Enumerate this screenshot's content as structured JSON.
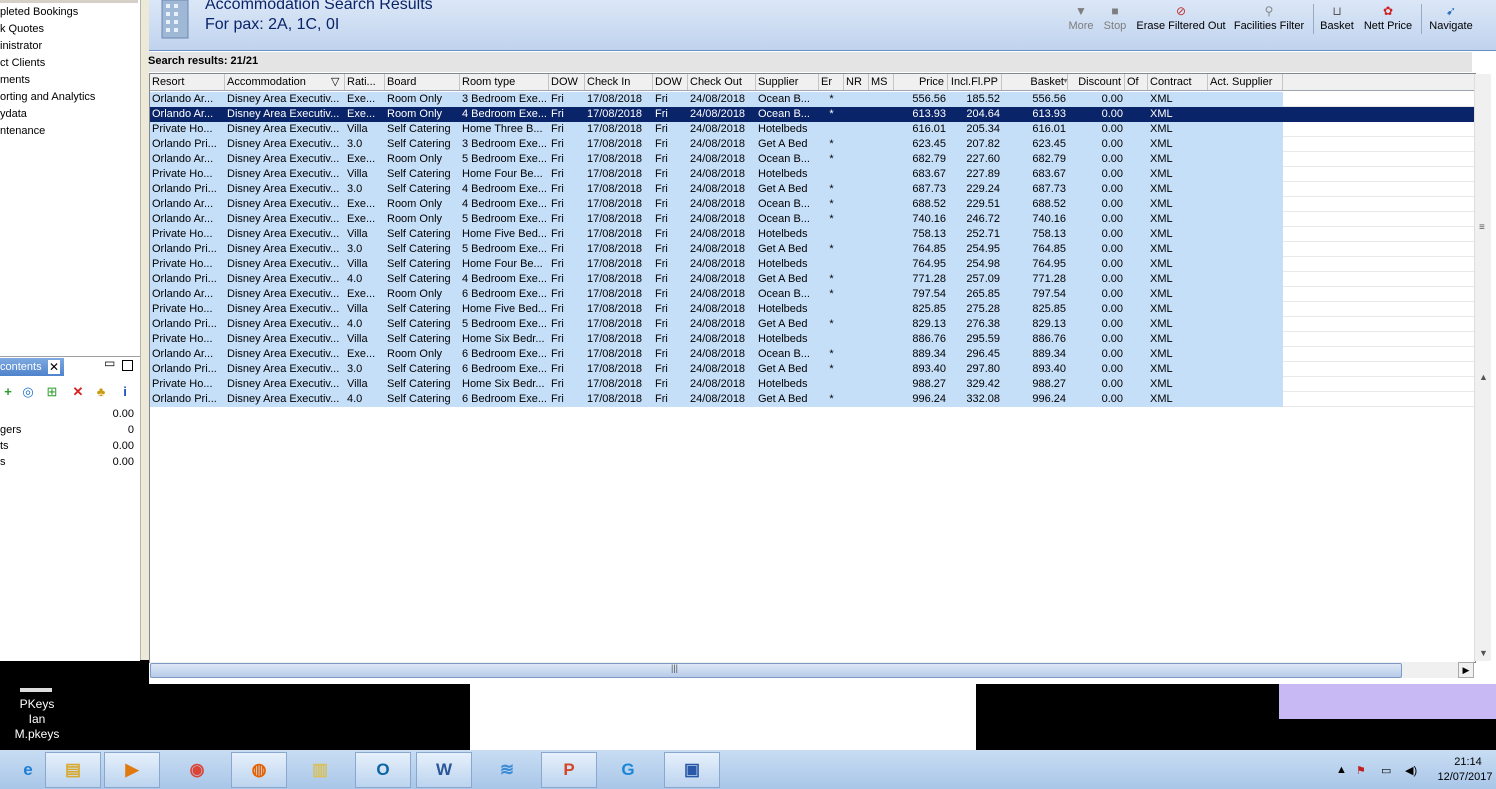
{
  "left_nav": {
    "items": [
      "pleted Bookings",
      "k Quotes",
      "inistrator",
      "ct Clients",
      "ments",
      "orting and Analytics",
      "ydata",
      "ntenance"
    ]
  },
  "contents_panel": {
    "tab_label": "contents",
    "summary": [
      {
        "label": "",
        "value": "0.00"
      },
      {
        "label": "gers",
        "value": "0"
      },
      {
        "label": "ts",
        "value": "0.00"
      },
      {
        "label": "s",
        "value": "0.00"
      }
    ]
  },
  "header": {
    "title": "Accommodation Search Results",
    "subtitle": "For pax: 2A, 1C, 0I"
  },
  "toolbar": {
    "more": "More",
    "stop": "Stop",
    "erase": "Erase Filtered Out",
    "facilities": "Facilities Filter",
    "basket": "Basket",
    "nett_price": "Nett Price",
    "navigate": "Navigate"
  },
  "results": {
    "label": "Search results: 21/21"
  },
  "grid": {
    "columns": [
      "Resort",
      "Accommodation",
      "Rati...",
      "Board",
      "Room type",
      "DOW",
      "Check In",
      "DOW",
      "Check Out",
      "Supplier",
      "Er",
      "NR",
      "MS",
      "Price",
      "Incl.Fl.PP",
      "Basket",
      "Discount",
      "Of",
      "Contract",
      "Act. Supplier"
    ],
    "rows": [
      [
        "Orlando Ar...",
        "Disney Area Executiv...",
        "Exe...",
        "Room Only",
        "3 Bedroom Exe...",
        "Fri",
        "17/08/2018",
        "Fri",
        "24/08/2018",
        "Ocean B...",
        "*",
        "",
        "",
        "556.56",
        "185.52",
        "556.56",
        "0.00",
        "",
        "XML",
        ""
      ],
      [
        "Orlando Ar...",
        "Disney Area Executiv...",
        "Exe...",
        "Room Only",
        "4 Bedroom Exe...",
        "Fri",
        "17/08/2018",
        "Fri",
        "24/08/2018",
        "Ocean B...",
        "*",
        "",
        "",
        "613.93",
        "204.64",
        "613.93",
        "0.00",
        "",
        "XML",
        ""
      ],
      [
        "Private Ho...",
        "Disney Area Executiv...",
        "Villa",
        "Self Catering",
        "Home Three B...",
        "Fri",
        "17/08/2018",
        "Fri",
        "24/08/2018",
        "Hotelbeds",
        "",
        "",
        "",
        "616.01",
        "205.34",
        "616.01",
        "0.00",
        "",
        "XML",
        ""
      ],
      [
        "Orlando Pri...",
        "Disney Area Executiv...",
        "3.0",
        "Self Catering",
        "3 Bedroom Exe...",
        "Fri",
        "17/08/2018",
        "Fri",
        "24/08/2018",
        "Get A Bed",
        "*",
        "",
        "",
        "623.45",
        "207.82",
        "623.45",
        "0.00",
        "",
        "XML",
        ""
      ],
      [
        "Orlando Ar...",
        "Disney Area Executiv...",
        "Exe...",
        "Room Only",
        "5 Bedroom Exe...",
        "Fri",
        "17/08/2018",
        "Fri",
        "24/08/2018",
        "Ocean B...",
        "*",
        "",
        "",
        "682.79",
        "227.60",
        "682.79",
        "0.00",
        "",
        "XML",
        ""
      ],
      [
        "Private Ho...",
        "Disney Area Executiv...",
        "Villa",
        "Self Catering",
        "Home Four Be...",
        "Fri",
        "17/08/2018",
        "Fri",
        "24/08/2018",
        "Hotelbeds",
        "",
        "",
        "",
        "683.67",
        "227.89",
        "683.67",
        "0.00",
        "",
        "XML",
        ""
      ],
      [
        "Orlando Pri...",
        "Disney Area Executiv...",
        "3.0",
        "Self Catering",
        "4 Bedroom Exe...",
        "Fri",
        "17/08/2018",
        "Fri",
        "24/08/2018",
        "Get A Bed",
        "*",
        "",
        "",
        "687.73",
        "229.24",
        "687.73",
        "0.00",
        "",
        "XML",
        ""
      ],
      [
        "Orlando Ar...",
        "Disney Area Executiv...",
        "Exe...",
        "Room Only",
        "4 Bedroom Exe...",
        "Fri",
        "17/08/2018",
        "Fri",
        "24/08/2018",
        "Ocean B...",
        "*",
        "",
        "",
        "688.52",
        "229.51",
        "688.52",
        "0.00",
        "",
        "XML",
        ""
      ],
      [
        "Orlando Ar...",
        "Disney Area Executiv...",
        "Exe...",
        "Room Only",
        "5 Bedroom Exe...",
        "Fri",
        "17/08/2018",
        "Fri",
        "24/08/2018",
        "Ocean B...",
        "*",
        "",
        "",
        "740.16",
        "246.72",
        "740.16",
        "0.00",
        "",
        "XML",
        ""
      ],
      [
        "Private Ho...",
        "Disney Area Executiv...",
        "Villa",
        "Self Catering",
        "Home Five Bed...",
        "Fri",
        "17/08/2018",
        "Fri",
        "24/08/2018",
        "Hotelbeds",
        "",
        "",
        "",
        "758.13",
        "252.71",
        "758.13",
        "0.00",
        "",
        "XML",
        ""
      ],
      [
        "Orlando Pri...",
        "Disney Area Executiv...",
        "3.0",
        "Self Catering",
        "5 Bedroom Exe...",
        "Fri",
        "17/08/2018",
        "Fri",
        "24/08/2018",
        "Get A Bed",
        "*",
        "",
        "",
        "764.85",
        "254.95",
        "764.85",
        "0.00",
        "",
        "XML",
        ""
      ],
      [
        "Private Ho...",
        "Disney Area Executiv...",
        "Villa",
        "Self Catering",
        "Home Four Be...",
        "Fri",
        "17/08/2018",
        "Fri",
        "24/08/2018",
        "Hotelbeds",
        "",
        "",
        "",
        "764.95",
        "254.98",
        "764.95",
        "0.00",
        "",
        "XML",
        ""
      ],
      [
        "Orlando Pri...",
        "Disney Area Executiv...",
        "4.0",
        "Self Catering",
        "4 Bedroom Exe...",
        "Fri",
        "17/08/2018",
        "Fri",
        "24/08/2018",
        "Get A Bed",
        "*",
        "",
        "",
        "771.28",
        "257.09",
        "771.28",
        "0.00",
        "",
        "XML",
        ""
      ],
      [
        "Orlando Ar...",
        "Disney Area Executiv...",
        "Exe...",
        "Room Only",
        "6 Bedroom Exe...",
        "Fri",
        "17/08/2018",
        "Fri",
        "24/08/2018",
        "Ocean B...",
        "*",
        "",
        "",
        "797.54",
        "265.85",
        "797.54",
        "0.00",
        "",
        "XML",
        ""
      ],
      [
        "Private Ho...",
        "Disney Area Executiv...",
        "Villa",
        "Self Catering",
        "Home Five Bed...",
        "Fri",
        "17/08/2018",
        "Fri",
        "24/08/2018",
        "Hotelbeds",
        "",
        "",
        "",
        "825.85",
        "275.28",
        "825.85",
        "0.00",
        "",
        "XML",
        ""
      ],
      [
        "Orlando Pri...",
        "Disney Area Executiv...",
        "4.0",
        "Self Catering",
        "5 Bedroom Exe...",
        "Fri",
        "17/08/2018",
        "Fri",
        "24/08/2018",
        "Get A Bed",
        "*",
        "",
        "",
        "829.13",
        "276.38",
        "829.13",
        "0.00",
        "",
        "XML",
        ""
      ],
      [
        "Private Ho...",
        "Disney Area Executiv...",
        "Villa",
        "Self Catering",
        "Home Six Bedr...",
        "Fri",
        "17/08/2018",
        "Fri",
        "24/08/2018",
        "Hotelbeds",
        "",
        "",
        "",
        "886.76",
        "295.59",
        "886.76",
        "0.00",
        "",
        "XML",
        ""
      ],
      [
        "Orlando Ar...",
        "Disney Area Executiv...",
        "Exe...",
        "Room Only",
        "6 Bedroom Exe...",
        "Fri",
        "17/08/2018",
        "Fri",
        "24/08/2018",
        "Ocean B...",
        "*",
        "",
        "",
        "889.34",
        "296.45",
        "889.34",
        "0.00",
        "",
        "XML",
        ""
      ],
      [
        "Orlando Pri...",
        "Disney Area Executiv...",
        "3.0",
        "Self Catering",
        "6 Bedroom Exe...",
        "Fri",
        "17/08/2018",
        "Fri",
        "24/08/2018",
        "Get A Bed",
        "*",
        "",
        "",
        "893.40",
        "297.80",
        "893.40",
        "0.00",
        "",
        "XML",
        ""
      ],
      [
        "Private Ho...",
        "Disney Area Executiv...",
        "Villa",
        "Self Catering",
        "Home Six Bedr...",
        "Fri",
        "17/08/2018",
        "Fri",
        "24/08/2018",
        "Hotelbeds",
        "",
        "",
        "",
        "988.27",
        "329.42",
        "988.27",
        "0.00",
        "",
        "XML",
        ""
      ],
      [
        "Orlando Pri...",
        "Disney Area Executiv...",
        "4.0",
        "Self Catering",
        "6 Bedroom Exe...",
        "Fri",
        "17/08/2018",
        "Fri",
        "24/08/2018",
        "Get A Bed",
        "*",
        "",
        "",
        "996.24",
        "332.08",
        "996.24",
        "0.00",
        "",
        "XML",
        ""
      ]
    ],
    "selected_row": 1
  },
  "desktop": {
    "user_label": "PKeys Ian M.pkeys"
  },
  "taskbar": {
    "apps": [
      {
        "name": "ie-icon",
        "glyph": "e",
        "color": "#1f7fd6"
      },
      {
        "name": "file-explorer-icon",
        "glyph": "▤",
        "color": "#d8a92f"
      },
      {
        "name": "media-player-icon",
        "glyph": "▶",
        "color": "#e07a10"
      },
      {
        "name": "chrome-icon",
        "glyph": "◉",
        "color": "#db4437"
      },
      {
        "name": "firefox-icon",
        "glyph": "◍",
        "color": "#e66000"
      },
      {
        "name": "folder-icon",
        "glyph": "▥",
        "color": "#d8c060"
      },
      {
        "name": "outlook-icon",
        "glyph": "O",
        "color": "#0a64a4"
      },
      {
        "name": "word-icon",
        "glyph": "W",
        "color": "#2b579a"
      },
      {
        "name": "app-icon",
        "glyph": "≋",
        "color": "#3a8ad6"
      },
      {
        "name": "powerpoint-icon",
        "glyph": "P",
        "color": "#d24726"
      },
      {
        "name": "app-c-icon",
        "glyph": "G",
        "color": "#1b86d6"
      },
      {
        "name": "remote-desktop-icon",
        "glyph": "▣",
        "color": "#2a58a8"
      }
    ],
    "time": "21:14",
    "date": "12/07/2017"
  }
}
